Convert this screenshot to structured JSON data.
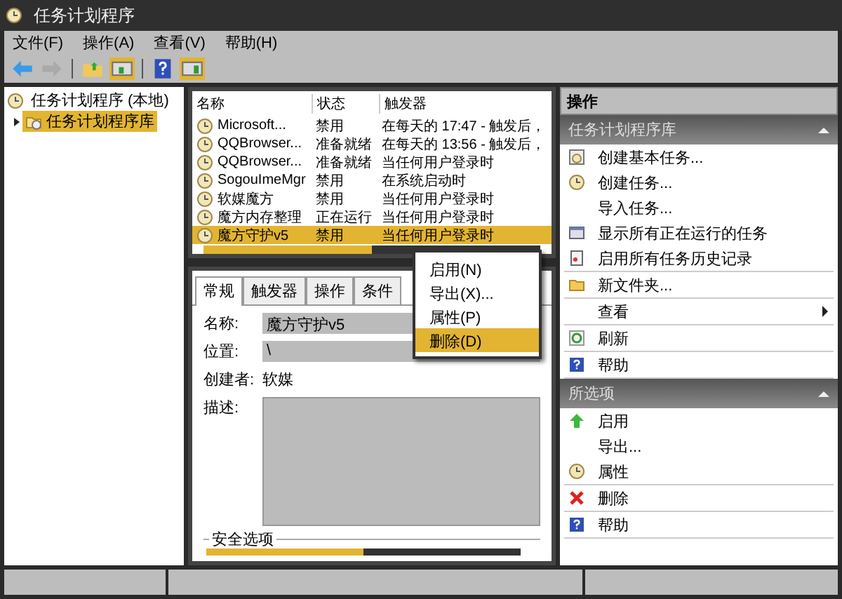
{
  "window": {
    "title": "任务计划程序"
  },
  "menu": [
    "文件(F)",
    "操作(A)",
    "查看(V)",
    "帮助(H)"
  ],
  "tree": [
    {
      "label": "任务计划程序 (本地)",
      "selected": false,
      "children": [
        {
          "label": "任务计划程序库",
          "expanded": false,
          "selected": true
        }
      ]
    }
  ],
  "tasks": {
    "columns": [
      "名称",
      "状态",
      "触发器"
    ],
    "rows": [
      {
        "name": "Microsoft...",
        "status": "禁用",
        "trigger": "在每天的 17:47 - 触发后，",
        "selected": false
      },
      {
        "name": "QQBrowser...",
        "status": "准备就绪",
        "trigger": "在每天的 13:56 - 触发后，",
        "selected": false
      },
      {
        "name": "QQBrowser...",
        "status": "准备就绪",
        "trigger": "当任何用户登录时",
        "selected": false
      },
      {
        "name": "SogouImeMgr",
        "status": "禁用",
        "trigger": "在系统启动时",
        "selected": false
      },
      {
        "name": "软媒魔方",
        "status": "禁用",
        "trigger": "当任何用户登录时",
        "selected": false
      },
      {
        "name": "魔方内存整理",
        "status": "正在运行",
        "trigger": "当任何用户登录时",
        "selected": false
      },
      {
        "name": "魔方守护v5",
        "status": "禁用",
        "trigger": "当任何用户登录时",
        "selected": true
      }
    ]
  },
  "context_menu": [
    {
      "label": "启用(N)",
      "selected": false
    },
    {
      "label": "导出(X)...",
      "selected": false
    },
    {
      "label": "属性(P)",
      "selected": false
    },
    {
      "label": "删除(D)",
      "selected": true
    }
  ],
  "details": {
    "tabs": [
      {
        "label": "常规",
        "selected": true
      },
      {
        "label": "触发器",
        "selected": false
      },
      {
        "label": "操作",
        "selected": false
      },
      {
        "label": "条件",
        "selected": false
      }
    ],
    "fields": [
      {
        "label": "名称:",
        "value": "魔方守护v5",
        "kind": "field"
      },
      {
        "label": "位置:",
        "value": "\\",
        "kind": "field"
      },
      {
        "label": "创建者:",
        "value": "软媒",
        "kind": "text"
      },
      {
        "label": "描述:",
        "kind": "area"
      }
    ],
    "group_label": "安全选项"
  },
  "actions": {
    "title": "操作",
    "sections": [
      {
        "title": "任务计划程序库",
        "expanded": true,
        "groups": [
          {
            "items": [
              {
                "label": "创建基本任务...",
                "submenu": false
              },
              {
                "label": "创建任务...",
                "submenu": false
              },
              {
                "label": "导入任务...",
                "submenu": false
              },
              {
                "label": "显示所有正在运行的任务",
                "submenu": false
              },
              {
                "label": "启用所有任务历史记录",
                "submenu": false
              }
            ]
          },
          {
            "items": [
              {
                "label": "新文件夹...",
                "submenu": false
              }
            ]
          },
          {
            "items": [
              {
                "label": "查看",
                "submenu": true
              }
            ]
          },
          {
            "items": [
              {
                "label": "刷新",
                "submenu": false
              }
            ]
          },
          {
            "items": [
              {
                "label": "帮助",
                "submenu": false
              }
            ]
          }
        ]
      },
      {
        "title": "所选项",
        "expanded": true,
        "groups": [
          {
            "items": [
              {
                "label": "启用",
                "submenu": false
              },
              {
                "label": "导出...",
                "submenu": false
              },
              {
                "label": "属性",
                "submenu": false
              }
            ]
          },
          {
            "items": [
              {
                "label": "删除",
                "submenu": false
              }
            ]
          },
          {
            "items": [
              {
                "label": "帮助",
                "submenu": false
              }
            ]
          }
        ]
      }
    ]
  }
}
